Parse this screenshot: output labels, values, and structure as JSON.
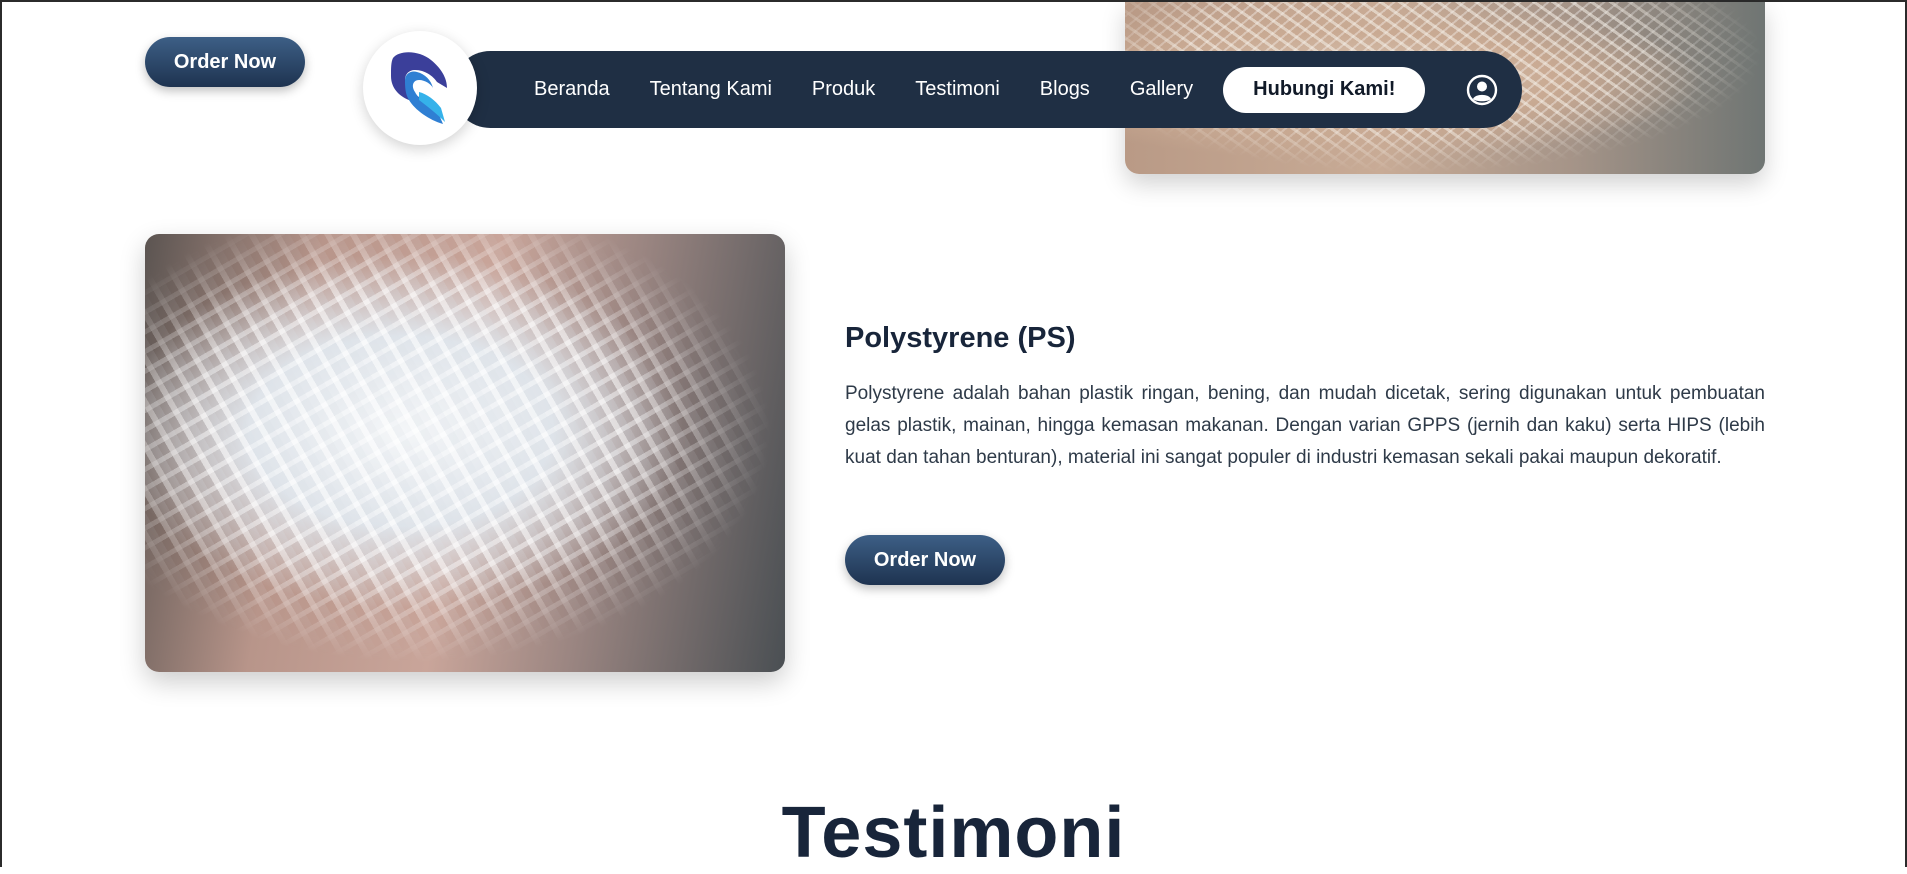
{
  "top_order_label": "Order Now",
  "navbar": {
    "links": [
      "Beranda",
      "Tentang Kami",
      "Produk",
      "Testimoni",
      "Blogs",
      "Gallery"
    ],
    "cta_label": "Hubungi Kami!",
    "user_icon": "user-circle-icon",
    "logo_icon": "bird-logo-icon"
  },
  "product": {
    "title": "Polystyrene (PS)",
    "description": "Polystyrene adalah bahan plastik ringan, bening, dan mudah dicetak, sering digunakan untuk pembuatan gelas plastik, mainan, hingga kemasan makanan. Dengan varian GPPS (jernih dan kaku) serta HIPS (lebih kuat dan tahan benturan), material ini sangat populer di industri kemasan sekali pakai maupun dekoratif.",
    "order_label": "Order Now"
  },
  "testimoni_heading": "Testimoni",
  "colors": {
    "navbar_bg": "#1f2f44",
    "button_gradient_top": "#3d5f86",
    "button_gradient_bottom": "#1e3350",
    "heading": "#18253a"
  }
}
